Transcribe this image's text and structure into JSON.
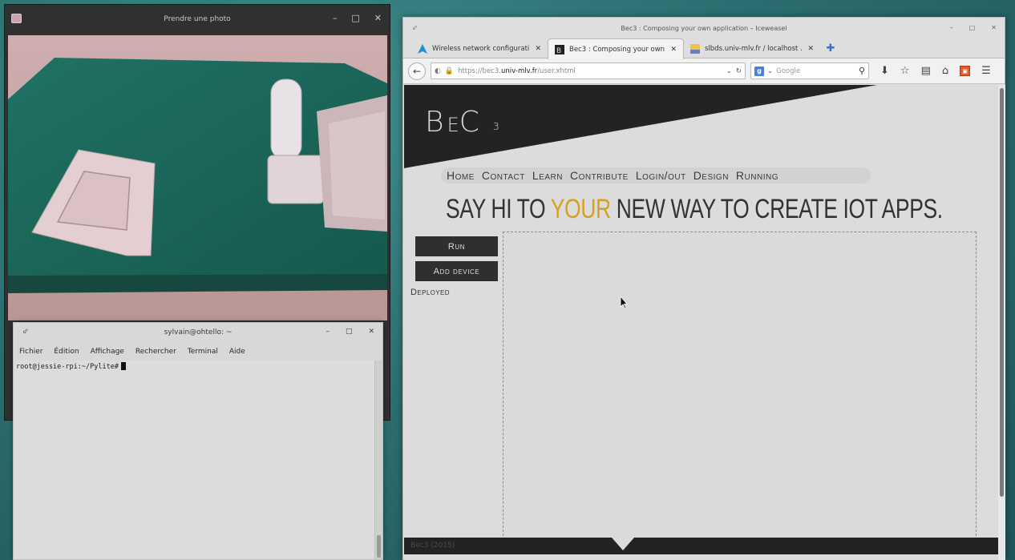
{
  "photo_window": {
    "title": "Prendre une photo",
    "controls": {
      "minimize": "–",
      "maximize": "□",
      "close": "✕"
    }
  },
  "terminal": {
    "title": "sylvain@ohtello: ~",
    "controls": {
      "minimize": "–",
      "maximize": "□",
      "close": "✕"
    },
    "menu": [
      "Fichier",
      "Édition",
      "Affichage",
      "Rechercher",
      "Terminal",
      "Aide"
    ],
    "prompt": "root@jessie-rpi:~/Pylite#"
  },
  "browser": {
    "title": "Bec3 : Composing your own application – Iceweasel",
    "controls": {
      "minimize": "–",
      "maximize": "□",
      "close": "✕"
    },
    "tabs": [
      {
        "label": "Wireless network configurati…",
        "active": false
      },
      {
        "label": "Bec3 : Composing your own …",
        "active": true
      },
      {
        "label": "slbds.univ-mlv.fr / localhost …",
        "active": false
      }
    ],
    "url_prefix": "https://bec3.",
    "url_domain": "univ-mlv.fr",
    "url_path": "/user.xhtml",
    "search_placeholder": "Google"
  },
  "site": {
    "logo": {
      "b": "B",
      "e": "E",
      "c": "C",
      "sup": "3"
    },
    "nav": [
      "Home",
      "Contact",
      "Learn",
      "Contribute",
      "Login/out",
      "Design",
      "Running"
    ],
    "headline_before": "SAY HI TO ",
    "headline_accent": "YOUR",
    "headline_after": " NEW WAY TO CREATE IOT APPS.",
    "run_button": "Run",
    "add_device_button": "Add device",
    "deployed_label": "Deployed",
    "footer": "Bec3 (2015)"
  },
  "colors": {
    "accent": "#d6a21e",
    "dark_banner": "#232323",
    "desktop": "#2c6f70"
  }
}
